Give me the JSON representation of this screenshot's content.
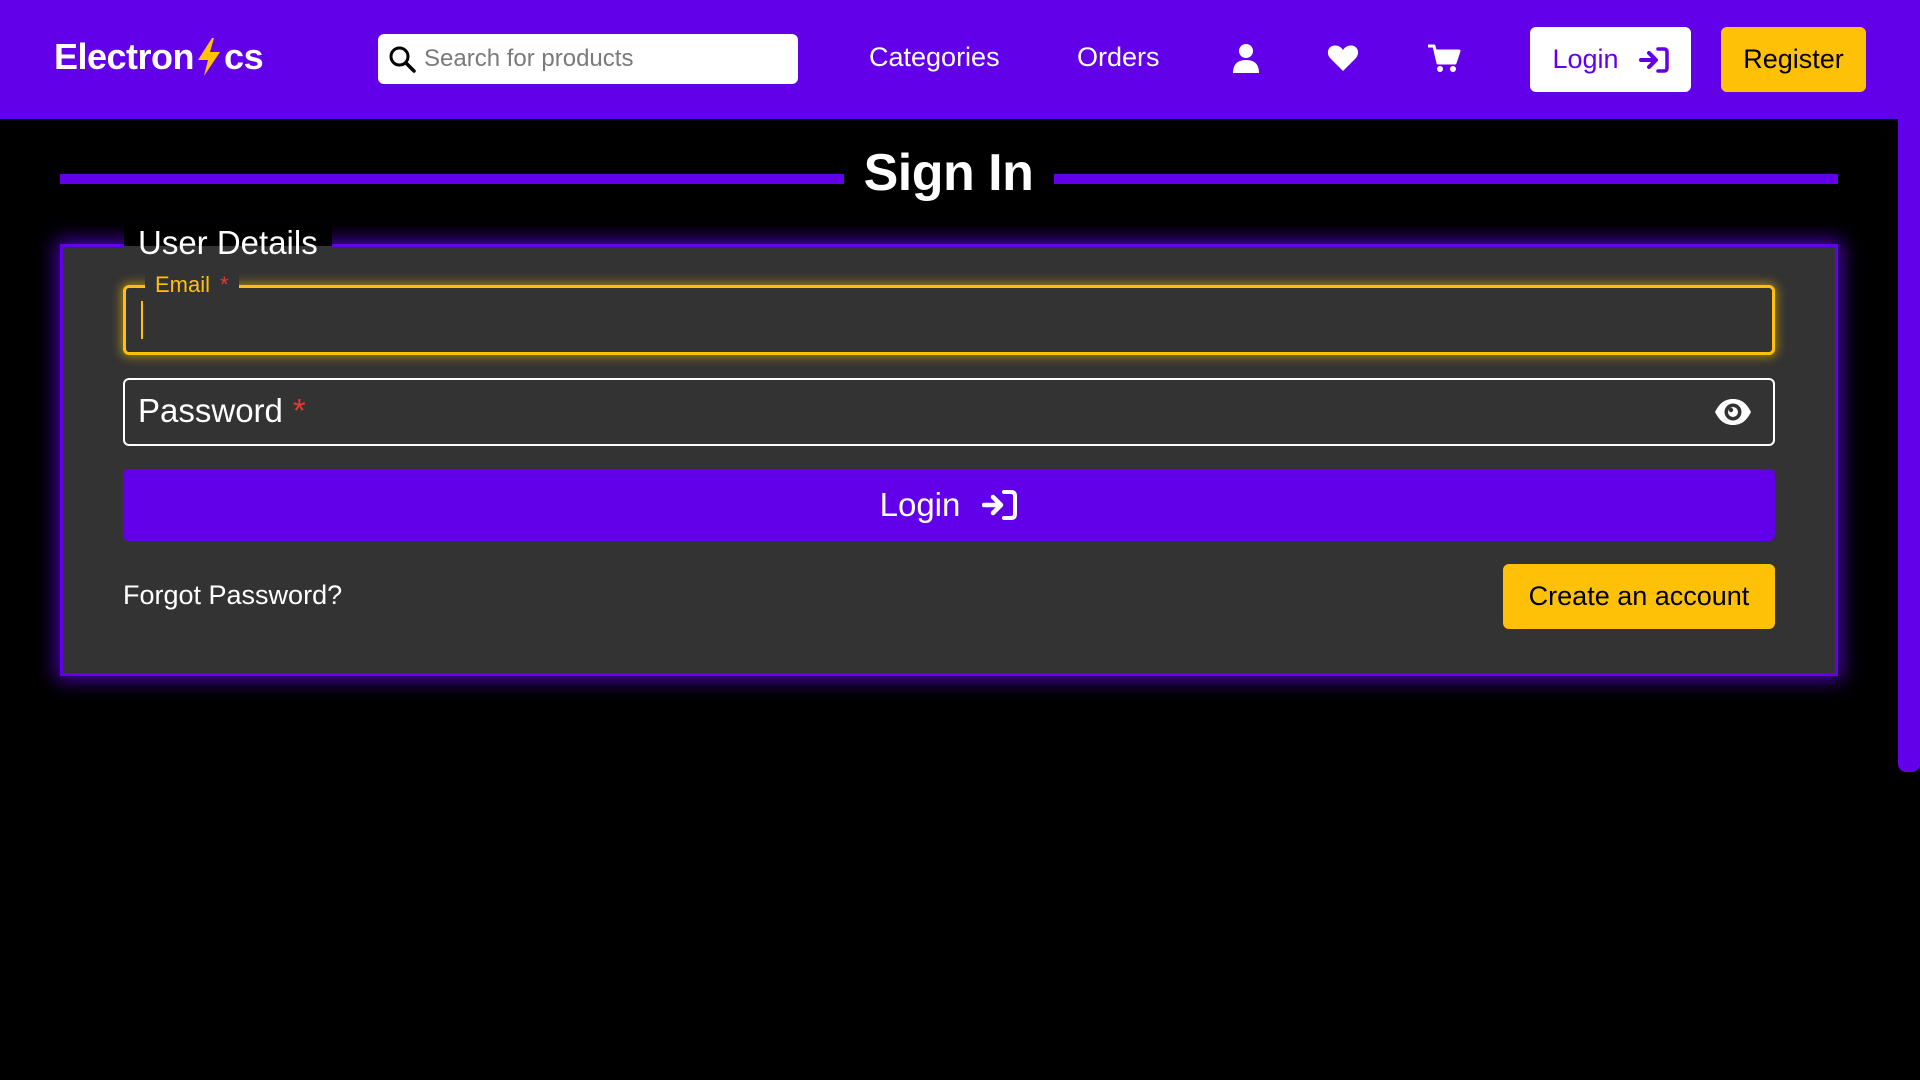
{
  "brand": {
    "logo_prefix": "Electron",
    "logo_icon": "lightning-bolt-icon",
    "logo_suffix": "cs"
  },
  "colors": {
    "primary": "#6200ea",
    "accent": "#fec107",
    "card_background": "#333333",
    "page_background": "#000000",
    "required": "#e53935"
  },
  "header": {
    "search": {
      "placeholder": "Search for products",
      "value": "",
      "icon": "search-icon"
    },
    "nav": {
      "categories": "Categories",
      "orders": "Orders"
    },
    "icons": [
      "user-icon",
      "heart-icon",
      "cart-icon"
    ],
    "login_label": "Login",
    "login_icon": "sign-in-icon",
    "register_label": "Register"
  },
  "page": {
    "title": "Sign In"
  },
  "form": {
    "legend": "User Details",
    "email": {
      "label": "Email",
      "required_marker": "*",
      "value": ""
    },
    "password": {
      "label": "Password",
      "required_marker": "*",
      "value": "",
      "toggle_icon": "eye-icon"
    },
    "submit_label": "Login",
    "submit_icon": "sign-in-icon",
    "forgot_label": "Forgot Password?",
    "create_account_label": "Create an account"
  }
}
